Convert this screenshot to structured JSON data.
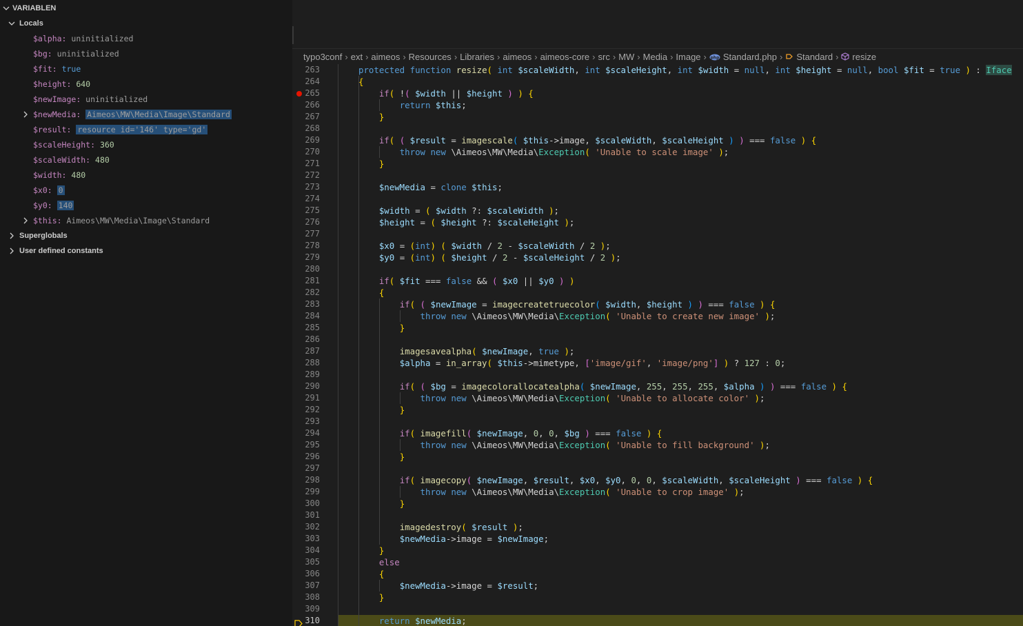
{
  "sidebar": {
    "section_title": "VARIABLEN",
    "scopes": {
      "locals": "Locals",
      "superglobals": "Superglobals",
      "user_constants": "User defined constants"
    },
    "locals": [
      {
        "name": "$alpha",
        "value": "uninitialized"
      },
      {
        "name": "$bg",
        "value": "uninitialized"
      },
      {
        "name": "$fit",
        "value": "true"
      },
      {
        "name": "$height",
        "value": "640"
      },
      {
        "name": "$newImage",
        "value": "uninitialized"
      },
      {
        "name": "$newMedia",
        "value": "Aimeos\\MW\\Media\\Image\\Standard"
      },
      {
        "name": "$result",
        "value": "resource id='146' type='gd'"
      },
      {
        "name": "$scaleHeight",
        "value": "360"
      },
      {
        "name": "$scaleWidth",
        "value": "480"
      },
      {
        "name": "$width",
        "value": "480"
      },
      {
        "name": "$x0",
        "value": "0"
      },
      {
        "name": "$y0",
        "value": "140"
      },
      {
        "name": "$this",
        "value": "Aimeos\\MW\\Media\\Image\\Standard"
      }
    ]
  },
  "breadcrumb": [
    "typo3conf",
    "ext",
    "aimeos",
    "Resources",
    "Libraries",
    "aimeos",
    "aimeos-core",
    "src",
    "MW",
    "Media",
    "Image",
    "Standard.php",
    "Standard",
    "resize"
  ],
  "editor": {
    "breakpoint_line": "265",
    "current_line": "310",
    "lines": [
      {
        "n": "263",
        "code": "protected function resize( int $scaleWidth, int $scaleHeight, int $width = null, int $height = null, bool $fit = true ) : Iface"
      },
      {
        "n": "264",
        "code": "{"
      },
      {
        "n": "265",
        "code": "    if( !( $width || $height ) ) {"
      },
      {
        "n": "266",
        "code": "        return $this;"
      },
      {
        "n": "267",
        "code": "    }"
      },
      {
        "n": "268",
        "code": ""
      },
      {
        "n": "269",
        "code": "    if( ( $result = imagescale( $this->image, $scaleWidth, $scaleHeight ) ) === false ) {"
      },
      {
        "n": "270",
        "code": "        throw new \\Aimeos\\MW\\Media\\Exception( 'Unable to scale image' );"
      },
      {
        "n": "271",
        "code": "    }"
      },
      {
        "n": "272",
        "code": ""
      },
      {
        "n": "273",
        "code": "    $newMedia = clone $this;"
      },
      {
        "n": "274",
        "code": ""
      },
      {
        "n": "275",
        "code": "    $width = ( $width ?: $scaleWidth );"
      },
      {
        "n": "276",
        "code": "    $height = ( $height ?: $scaleHeight );"
      },
      {
        "n": "277",
        "code": ""
      },
      {
        "n": "278",
        "code": "    $x0 = (int) ( $width / 2 - $scaleWidth / 2 );"
      },
      {
        "n": "279",
        "code": "    $y0 = (int) ( $height / 2 - $scaleHeight / 2 );"
      },
      {
        "n": "280",
        "code": ""
      },
      {
        "n": "281",
        "code": "    if( $fit === false && ( $x0 || $y0 ) )"
      },
      {
        "n": "282",
        "code": "    {"
      },
      {
        "n": "283",
        "code": "        if( ( $newImage = imagecreatetruecolor( $width, $height ) ) === false ) {"
      },
      {
        "n": "284",
        "code": "            throw new \\Aimeos\\MW\\Media\\Exception( 'Unable to create new image' );"
      },
      {
        "n": "285",
        "code": "        }"
      },
      {
        "n": "286",
        "code": ""
      },
      {
        "n": "287",
        "code": "        imagesavealpha( $newImage, true );"
      },
      {
        "n": "288",
        "code": "        $alpha = in_array( $this->mimetype, ['image/gif', 'image/png'] ) ? 127 : 0;"
      },
      {
        "n": "289",
        "code": ""
      },
      {
        "n": "290",
        "code": "        if( ( $bg = imagecolorallocatealpha( $newImage, 255, 255, 255, $alpha ) ) === false ) {"
      },
      {
        "n": "291",
        "code": "            throw new \\Aimeos\\MW\\Media\\Exception( 'Unable to allocate color' );"
      },
      {
        "n": "292",
        "code": "        }"
      },
      {
        "n": "293",
        "code": ""
      },
      {
        "n": "294",
        "code": "        if( imagefill( $newImage, 0, 0, $bg ) === false ) {"
      },
      {
        "n": "295",
        "code": "            throw new \\Aimeos\\MW\\Media\\Exception( 'Unable to fill background' );"
      },
      {
        "n": "296",
        "code": "        }"
      },
      {
        "n": "297",
        "code": ""
      },
      {
        "n": "298",
        "code": "        if( imagecopy( $newImage, $result, $x0, $y0, 0, 0, $scaleWidth, $scaleHeight ) === false ) {"
      },
      {
        "n": "299",
        "code": "            throw new \\Aimeos\\MW\\Media\\Exception( 'Unable to crop image' );"
      },
      {
        "n": "300",
        "code": "        }"
      },
      {
        "n": "301",
        "code": ""
      },
      {
        "n": "302",
        "code": "        imagedestroy( $result );"
      },
      {
        "n": "303",
        "code": "        $newMedia->image = $newImage;"
      },
      {
        "n": "304",
        "code": "    }"
      },
      {
        "n": "305",
        "code": "    else"
      },
      {
        "n": "306",
        "code": "    {"
      },
      {
        "n": "307",
        "code": "        $newMedia->image = $result;"
      },
      {
        "n": "308",
        "code": "    }"
      },
      {
        "n": "309",
        "code": ""
      },
      {
        "n": "310",
        "code": "    return $newMedia;"
      }
    ]
  },
  "colors": {
    "sidebar_bg": "#181818",
    "editor_bg": "#1e1e1e",
    "breakpoint": "#e51400",
    "current_line": "#4b4b18",
    "selection": "#264f78"
  }
}
